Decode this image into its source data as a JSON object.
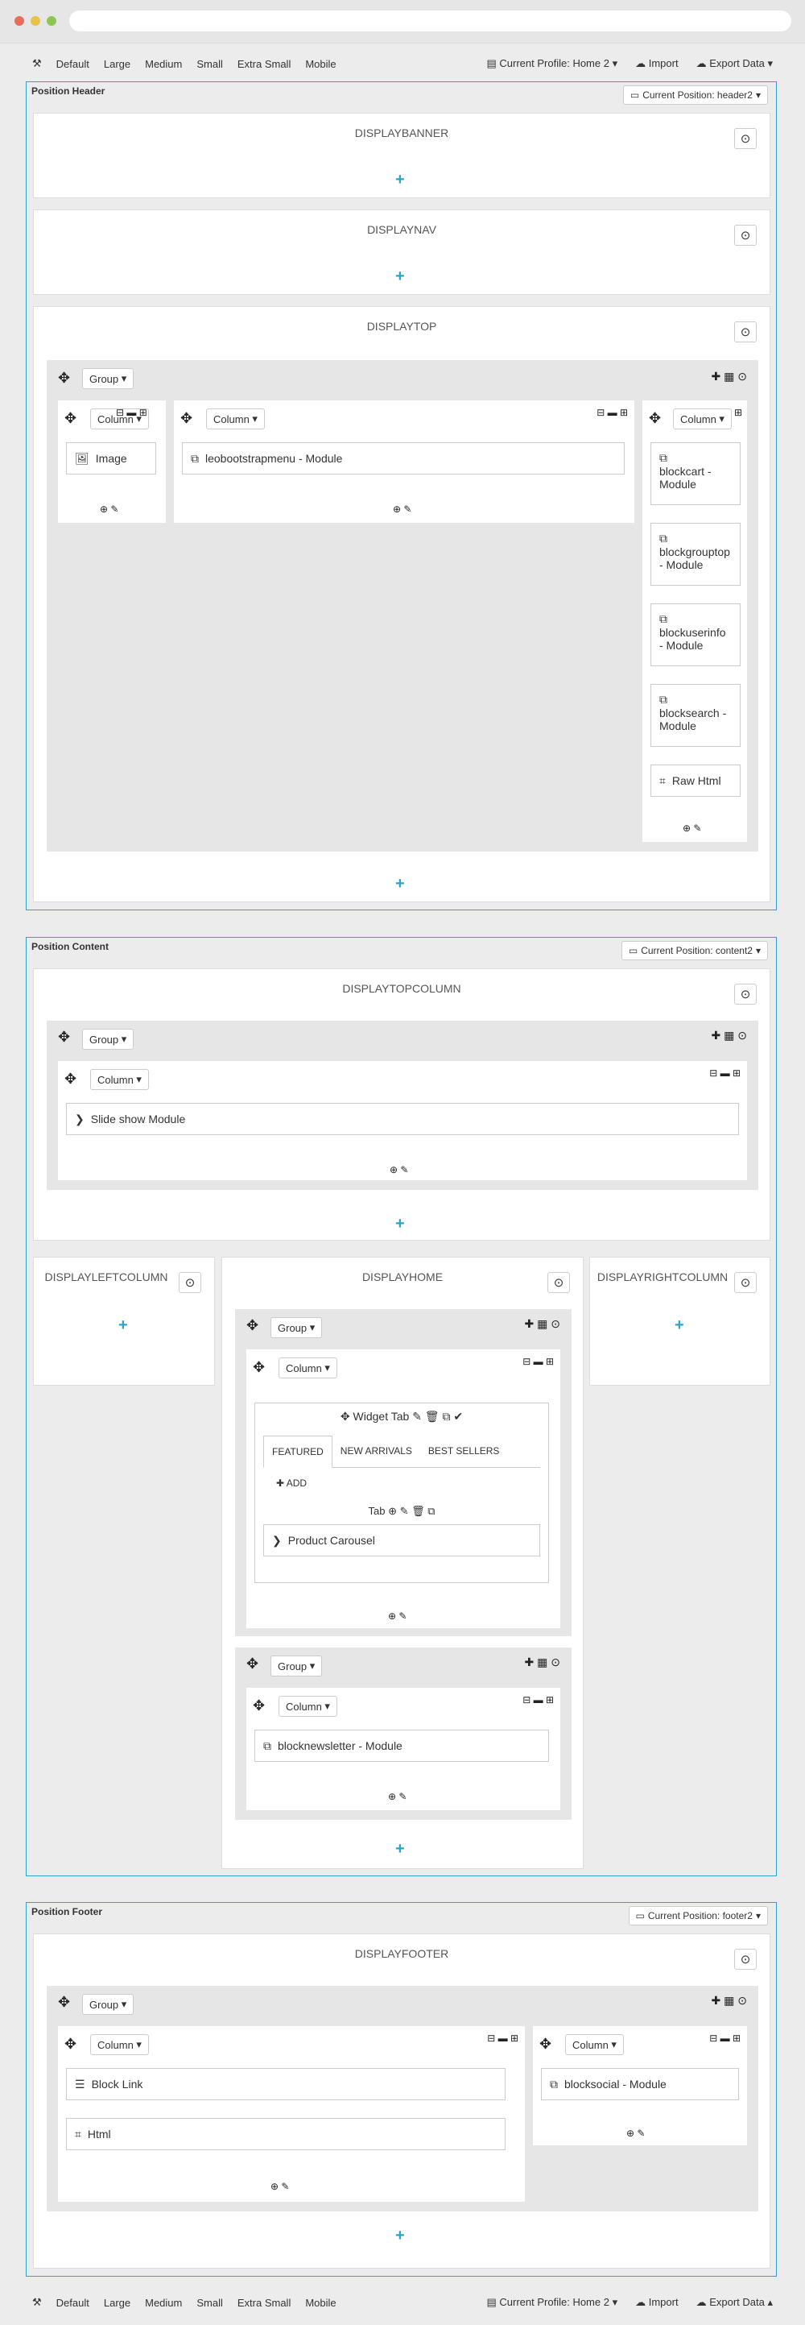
{
  "toolbar": {
    "devices": [
      "Default",
      "Large",
      "Medium",
      "Small",
      "Extra Small",
      "Mobile"
    ],
    "profile": "Current Profile: Home 2",
    "import": "Import",
    "export": "Export Data"
  },
  "header": {
    "title": "Position Header",
    "current": "Current Position: header2",
    "hooks": [
      "DISPLAYBANNER",
      "DISPLAYNAV",
      "DISPLAYTOP"
    ],
    "group": "Group",
    "column": "Column",
    "widgets": {
      "image": "Image",
      "menu": "leobootstrapmenu - Module",
      "cart": "blockcart - Module",
      "grouptop": "blockgrouptop - Module",
      "userinfo": "blockuserinfo - Module",
      "search": "blocksearch - Module",
      "rawhtml": "Raw Html"
    }
  },
  "content": {
    "title": "Position Content",
    "current": "Current Position: content2",
    "hooks": [
      "DISPLAYTOPCOLUMN",
      "DISPLAYLEFTCOLUMN",
      "DISPLAYHOME",
      "DISPLAYRIGHTCOLUMN"
    ],
    "slideshow": "Slide show Module",
    "widget_tab": "Widget Tab",
    "tabs": [
      "FEATURED",
      "NEW ARRIVALS",
      "BEST SELLERS"
    ],
    "add": "ADD",
    "tab_label": "Tab",
    "carousel": "Product Carousel",
    "newsletter": "blocknewsletter - Module"
  },
  "footer": {
    "title": "Position Footer",
    "current": "Current Position: footer2",
    "hook": "DISPLAYFOOTER",
    "blocklink": "Block Link",
    "html": "Html",
    "social": "blocksocial - Module"
  },
  "colors": {
    "accent": "#2aa3d3",
    "background": "#ececec"
  }
}
